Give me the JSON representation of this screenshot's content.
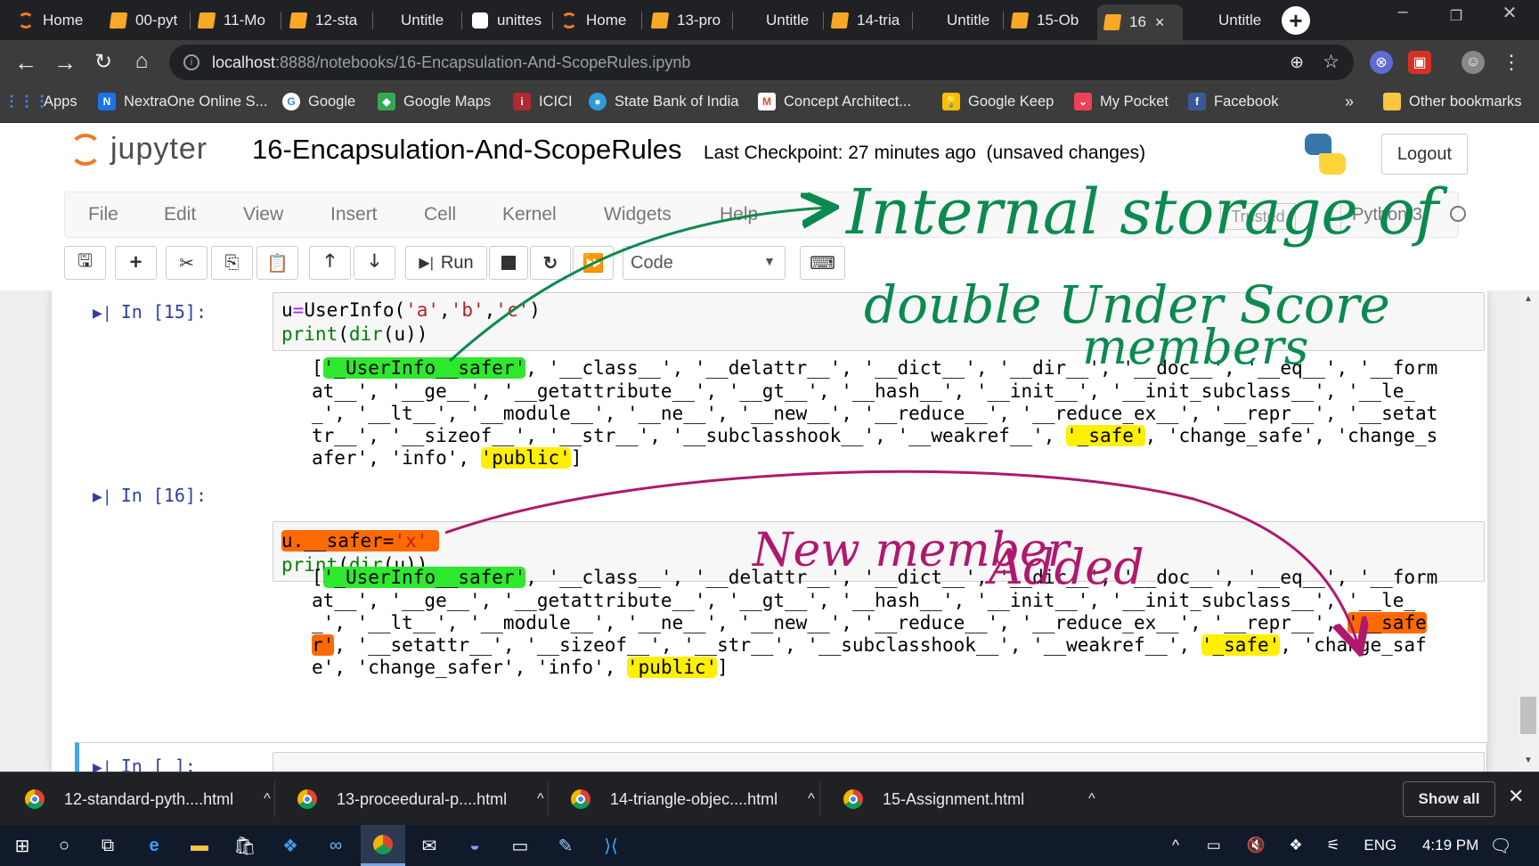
{
  "browser": {
    "tabs": [
      {
        "label": "Home",
        "icon": "jupyter-icon"
      },
      {
        "label": "00-pyt",
        "icon": "notebook-icon"
      },
      {
        "label": "11-Mo",
        "icon": "notebook-icon"
      },
      {
        "label": "12-sta",
        "icon": "notebook-icon"
      },
      {
        "label": "Untitle",
        "icon": "none"
      },
      {
        "label": "unittes",
        "icon": "white-box-icon"
      },
      {
        "label": "Home",
        "icon": "jupyter-icon"
      },
      {
        "label": "13-pro",
        "icon": "notebook-icon"
      },
      {
        "label": "Untitle",
        "icon": "none"
      },
      {
        "label": "14-tria",
        "icon": "notebook-icon"
      },
      {
        "label": "Untitle",
        "icon": "none"
      },
      {
        "label": "15-Ob",
        "icon": "notebook-icon"
      },
      {
        "label": "16",
        "icon": "notebook-icon",
        "active": true
      },
      {
        "label": "Untitle",
        "icon": "none"
      }
    ],
    "close_glyph": "×",
    "new_tab_glyph": "+",
    "url_host": "localhost",
    "url_path": ":8888/notebooks/16-Encapsulation-And-ScopeRules.ipynb",
    "bookmarks": [
      {
        "label": "Apps",
        "icon": "apps-grid-icon",
        "color": "#4285f4"
      },
      {
        "label": "NextraOne Online S...",
        "icon": "nextraone-icon",
        "color": "#1a73e8"
      },
      {
        "label": "Google",
        "icon": "google-icon",
        "color": "#ffffff"
      },
      {
        "label": "Google Maps",
        "icon": "maps-icon",
        "color": "#34a853"
      },
      {
        "label": "ICICI",
        "icon": "icici-icon",
        "color": "#b02a30"
      },
      {
        "label": "State Bank of India",
        "icon": "sbi-icon",
        "color": "#2d9cdb"
      },
      {
        "label": "Concept Architect...",
        "icon": "gmail-icon",
        "color": "#ea4335"
      },
      {
        "label": "Google Keep",
        "icon": "keep-icon",
        "color": "#fbbc04"
      },
      {
        "label": "My Pocket",
        "icon": "pocket-icon",
        "color": "#ef4056"
      },
      {
        "label": "Facebook",
        "icon": "facebook-icon",
        "color": "#3b5998"
      }
    ],
    "bookmarks_more": "»",
    "other_bookmarks": "Other bookmarks"
  },
  "jupyter": {
    "logo_text": "jupyter",
    "notebook_name": "16-Encapsulation-And-ScopeRules",
    "checkpoint": "Last Checkpoint: 27 minutes ago",
    "unsaved": "(unsaved changes)",
    "logout": "Logout",
    "menu": [
      "File",
      "Edit",
      "View",
      "Insert",
      "Cell",
      "Kernel",
      "Widgets",
      "Help"
    ],
    "trusted": "Trusted",
    "kernel": "Python 3",
    "run_label": "Run",
    "cell_type": "Code"
  },
  "cells": [
    {
      "prompt": "In [15]:",
      "code_line1": "u=UserInfo('a','b','c')",
      "code_line2": "print(dir(u))",
      "output_lines": [
        "['_UserInfo__safer', '__class__', '__delattr__', '__dict__', '__dir__', '__doc__', '__eq__', '__form",
        "at__', '__ge__', '__getattribute__', '__gt__', '__hash__', '__init__', '__init_subclass__', '__le_",
        "_', '__lt__', '__module__', '__ne__', '__new__', '__reduce__', '__reduce_ex__', '__repr__', '__setat",
        "tr__', '__sizeof__', '__str__', '__subclasshook__', '__weakref__', '_safe', 'change_safe', 'change_s",
        "afer', 'info', 'public']"
      ]
    },
    {
      "prompt": "In [16]:",
      "code_line1": "u.__safer='x'",
      "code_line2": "print(dir(u))",
      "output_lines": [
        "['_UserInfo__safer', '__class__', '__delattr__', '__dict__', '__dir__', '__doc__', '__eq__', '__form",
        "at__', '__ge__', '__getattribute__', '__gt__', '__hash__', '__init__', '__init_subclass__', '__le_",
        "_', '__lt__', '__module__', '__ne__', '__new__', '__reduce__', '__reduce_ex__', '__repr__', '__safe",
        "r', '__setattr__', '__sizeof__', '__str__', '__subclasshook__', '__weakref__', '_safe', 'change_saf",
        "e', 'change_safer', 'info', 'public']"
      ]
    },
    {
      "prompt": "In [ ]:"
    }
  ],
  "annotations": {
    "green_text_line1": "Internal storage of",
    "green_text_line2": "double Under Score",
    "green_text_line3": "members",
    "purple_text_line1": "New member",
    "purple_text_line2": "Added",
    "green_color": "#0b8a4f",
    "purple_color": "#b0186e"
  },
  "downloads": {
    "items": [
      "12-standard-pyth....html",
      "13-proceedural-p....html",
      "14-triangle-objec....html",
      "15-Assignment.html"
    ],
    "show_all": "Show all",
    "close_glyph": "✕"
  },
  "taskbar": {
    "language": "ENG",
    "time": "4:19 PM"
  }
}
